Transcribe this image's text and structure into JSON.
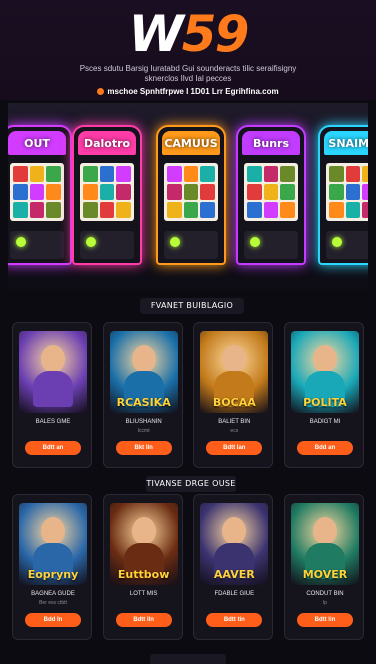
{
  "header": {
    "logo_w": "W",
    "logo_num": "59",
    "tagline_line1": "Psces sdutu Barsig Iuratabd Gui sounderacts tilic seraifisigny",
    "tagline_line2": "sknerclos Ilvd Ial pecces",
    "promo": "mschoe Spnhtfrpwe  I 1D01 Lrr Egrihfina.com"
  },
  "hero": {
    "machines": [
      {
        "label": "OUT",
        "color": "#d23cff"
      },
      {
        "label": "Dalotro",
        "color": "#ff3ca8"
      },
      {
        "label": "CAMUUS",
        "color": "#ff9a1a"
      },
      {
        "label": "Bunrs",
        "color": "#c23cff"
      },
      {
        "label": "SNAIMA",
        "color": "#2ad6ff"
      }
    ]
  },
  "sections": [
    {
      "title": "FVANET BUIBLAGIO",
      "games": [
        {
          "art": "",
          "name": "BALES GME",
          "sub": "",
          "button": "Bdtt an",
          "theme": "#6b3fb2"
        },
        {
          "art": "RCASIKA",
          "name": "BLIUSHANIN",
          "sub": "Iccmt",
          "button": "Bkt Iln",
          "theme": "#1a6fa8"
        },
        {
          "art": "BOCAA",
          "name": "BALIET BIN",
          "sub": "ecs",
          "button": "Bdtt Ian",
          "theme": "#c27a1a"
        },
        {
          "art": "POLITA",
          "name": "BADIGT MI",
          "sub": "",
          "button": "Bdd an",
          "theme": "#19a8b8"
        }
      ]
    },
    {
      "title": "TIVANSE DRGE OUSE",
      "games": [
        {
          "art": "Eopryny",
          "name": "BAGNEA GUDE",
          "sub": "Ber ess ctbtt",
          "button": "Bdd ln",
          "theme": "#2a67a8"
        },
        {
          "art": "Euttbow",
          "name": "LOTT MIS",
          "sub": "",
          "button": "Bdtt lln",
          "theme": "#6a2c12"
        },
        {
          "art": "AAVER",
          "name": "FDABLE GIUE",
          "sub": "",
          "button": "Bdtt tin",
          "theme": "#3b3370"
        },
        {
          "art": "MOVER",
          "name": "CONDUT BIN",
          "sub": "Ip",
          "button": "Bdtt lin",
          "theme": "#1f7b62"
        }
      ]
    }
  ],
  "colors": {
    "accent": "#ff5e1a",
    "background": "#0c0b12"
  }
}
